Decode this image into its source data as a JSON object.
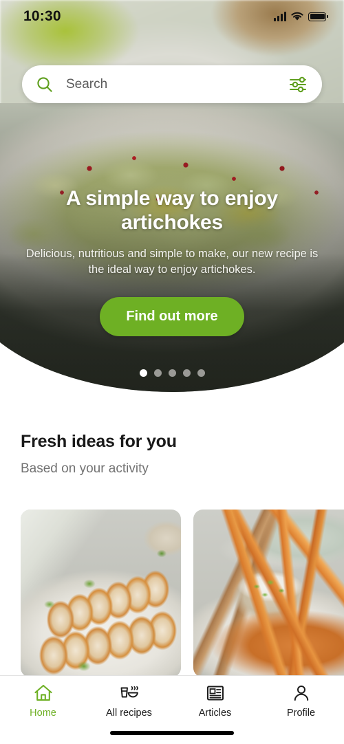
{
  "status_bar": {
    "time": "10:30",
    "signal_icon": "cellular-signal-icon",
    "wifi_icon": "wifi-icon",
    "battery_icon": "battery-full-icon"
  },
  "search": {
    "placeholder": "Search",
    "value": "",
    "search_icon": "search-icon",
    "filter_icon": "filter-sliders-icon"
  },
  "hero": {
    "title": "A simple way to enjoy artichokes",
    "subtitle": "Delicious, nutritious and simple to make, our new recipe is the ideal way to enjoy artichokes.",
    "cta_label": "Find out more",
    "image_alt": "artichoke salad on a white plate",
    "carousel": {
      "total": 5,
      "active_index": 0
    }
  },
  "section": {
    "title": "Fresh ideas for you",
    "subtitle": "Based on your activity"
  },
  "cards": [
    {
      "image_alt": "sliced roasted chicken breast on a white plate with parsley"
    },
    {
      "image_alt": "sweet potato fries with a bowl of white dip and chives"
    }
  ],
  "bottom_nav": {
    "items": [
      {
        "label": "Home",
        "icon": "home-icon",
        "active": true
      },
      {
        "label": "All recipes",
        "icon": "food-drink-icon",
        "active": false
      },
      {
        "label": "Articles",
        "icon": "newspaper-icon",
        "active": false
      },
      {
        "label": "Profile",
        "icon": "person-icon",
        "active": false
      }
    ]
  },
  "colors": {
    "brand_green": "#6eb024",
    "text_dark": "#1a1a1a",
    "text_muted": "#717171"
  }
}
